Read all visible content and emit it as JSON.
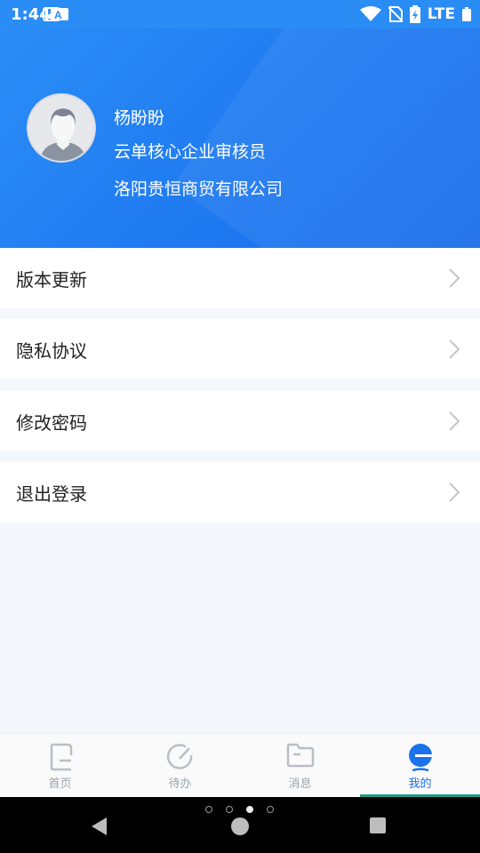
{
  "status_bar": {
    "time": "1:44",
    "network": "LTE"
  },
  "profile": {
    "name": "杨盼盼",
    "role": "云单核心企业审核员",
    "company": "洛阳贵恒商贸有限公司"
  },
  "menu": [
    {
      "label": "版本更新"
    },
    {
      "label": "隐私协议"
    },
    {
      "label": "修改密码"
    },
    {
      "label": "退出登录"
    }
  ],
  "tabs": [
    {
      "label": "首页",
      "icon": "home-icon"
    },
    {
      "label": "待办",
      "icon": "todo-icon"
    },
    {
      "label": "消息",
      "icon": "message-icon"
    },
    {
      "label": "我的",
      "icon": "profile-icon",
      "active": true
    }
  ],
  "colors": {
    "primary": "#1b72ea",
    "header": "#2b8df6",
    "indicator": "#1a9e89"
  }
}
